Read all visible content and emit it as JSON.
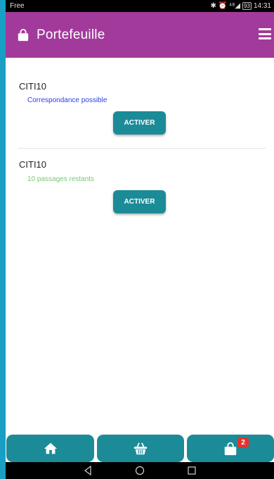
{
  "status_bar": {
    "carrier": "Free",
    "icons_text": "✱ ⏰ ⁴⁸◢",
    "battery": "93",
    "time": "14:31"
  },
  "app_bar": {
    "title": "Portefeuille",
    "icon": "shopping-bag-icon",
    "menu_icon": "hamburger-menu-icon"
  },
  "tickets": [
    {
      "name": "CITI10",
      "info": "Correspondance possible",
      "info_color": "#2b3ee8",
      "button_label": "ACTIVER"
    },
    {
      "name": "CITI10",
      "info": "10 passages restants",
      "info_color": "#7cc47a",
      "button_label": "ACTIVER"
    }
  ],
  "bottom_nav": {
    "items": [
      {
        "icon": "home-icon"
      },
      {
        "icon": "basket-icon"
      },
      {
        "icon": "shopping-bag-icon",
        "badge": "2"
      }
    ]
  },
  "system_nav": {
    "items": [
      "back-icon",
      "home-circle-icon",
      "recent-apps-icon"
    ]
  },
  "colors": {
    "app_bar": "#a23a9b",
    "button": "#1b8b98",
    "background": "#1a9fc4",
    "badge": "#e5322d"
  }
}
